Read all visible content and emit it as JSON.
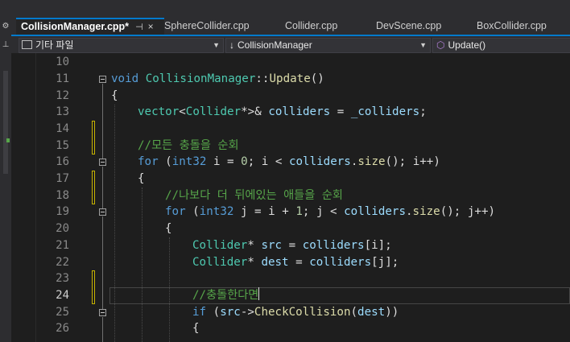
{
  "tabs": [
    {
      "label": "CollisionManager.cpp*",
      "active": true,
      "pin": "⊣",
      "close": "×"
    },
    {
      "label": "SphereCollider.cpp"
    },
    {
      "label": "Collider.cpp"
    },
    {
      "label": "DevScene.cpp"
    },
    {
      "label": "BoxCollider.cpp"
    }
  ],
  "navbar": {
    "project": "기타 파일",
    "scope": "CollisionManager",
    "member": "Update()"
  },
  "editor": {
    "current_line": 24,
    "lines": [
      {
        "num": "10"
      },
      {
        "num": "11"
      },
      {
        "num": "12"
      },
      {
        "num": "13"
      },
      {
        "num": "14"
      },
      {
        "num": "15"
      },
      {
        "num": "16"
      },
      {
        "num": "17"
      },
      {
        "num": "18"
      },
      {
        "num": "19"
      },
      {
        "num": "20"
      },
      {
        "num": "21"
      },
      {
        "num": "22"
      },
      {
        "num": "23"
      },
      {
        "num": "24"
      },
      {
        "num": "25"
      },
      {
        "num": "26"
      }
    ],
    "tokens": {
      "l11_void": "void",
      "l11_class": "CollisionManager",
      "l11_sep": "::",
      "l11_fn": "Update",
      "l11_par": "()",
      "l12": "{",
      "l13_vec": "vector",
      "l13_lt": "<",
      "l13_col": "Collider",
      "l13_rest1": "*>& ",
      "l13_var": "colliders",
      "l13_eq": " = ",
      "l13_mem": "_colliders",
      "l13_semi": ";",
      "l15": "//모든 충돌을 순회",
      "l16_for": "for",
      "l16_a": " (",
      "l16_type": "int32",
      "l16_b": " i = ",
      "l16_zero": "0",
      "l16_c": "; i < ",
      "l16_var": "colliders",
      "l16_d": ".",
      "l16_size": "size",
      "l16_e": "(); i++)",
      "l17": "{",
      "l18": "//나보다 더 뒤에있는 애들을 순회",
      "l19_for": "for",
      "l19_a": " (",
      "l19_type": "int32",
      "l19_b": " j = i + ",
      "l19_one": "1",
      "l19_c": "; j < ",
      "l19_var": "colliders",
      "l19_d": ".",
      "l19_size": "size",
      "l19_e": "(); j++)",
      "l20": "{",
      "l21_type": "Collider",
      "l21_a": "* ",
      "l21_var": "src",
      "l21_b": " = ",
      "l21_col": "colliders",
      "l21_c": "[i];",
      "l22_type": "Collider",
      "l22_a": "* ",
      "l22_var": "dest",
      "l22_b": " = ",
      "l22_col": "colliders",
      "l22_c": "[j];",
      "l24": "//충돌한다면",
      "l25_if": "if",
      "l25_a": " (",
      "l25_src": "src",
      "l25_arrow": "->",
      "l25_fn": "CheckCollision",
      "l25_b": "(",
      "l25_dest": "dest",
      "l25_c": "))",
      "l26": "{"
    }
  }
}
